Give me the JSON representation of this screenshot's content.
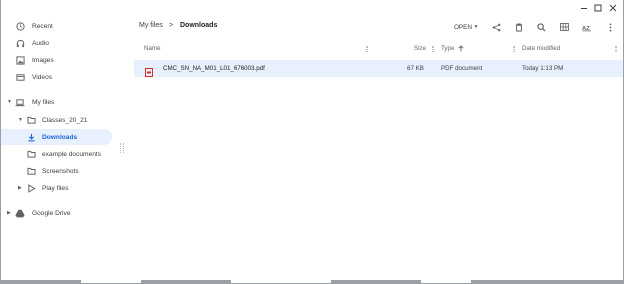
{
  "window": {
    "controls": {
      "minimize_icon": "minimize-icon",
      "maximize_icon": "maximize-icon",
      "close_icon": "close-icon"
    }
  },
  "sidebar": {
    "recent": "Recent",
    "audio": "Audio",
    "images": "Images",
    "videos": "Videos",
    "my_files": "My files",
    "classes": "Classes_20_21",
    "downloads": "Downloads",
    "example_documents": "example documents",
    "screenshots": "Screenshots",
    "play_files": "Play files",
    "google_drive": "Google Drive"
  },
  "breadcrumb": {
    "root": "My files",
    "separator": ">",
    "current": "Downloads"
  },
  "toolbar": {
    "open_label": "OPEN"
  },
  "columns": {
    "name": "Name",
    "size": "Size",
    "type": "Type",
    "date": "Date modified"
  },
  "files": [
    {
      "name": "CMC_SN_NA_M01_L01_676003.pdf",
      "size": "67 KB",
      "type": "PDF document",
      "date": "Today 1:13 PM"
    }
  ],
  "colors": {
    "accent": "#1a73e8",
    "selection": "#e8f0fe",
    "pdf_red": "#d93025"
  }
}
